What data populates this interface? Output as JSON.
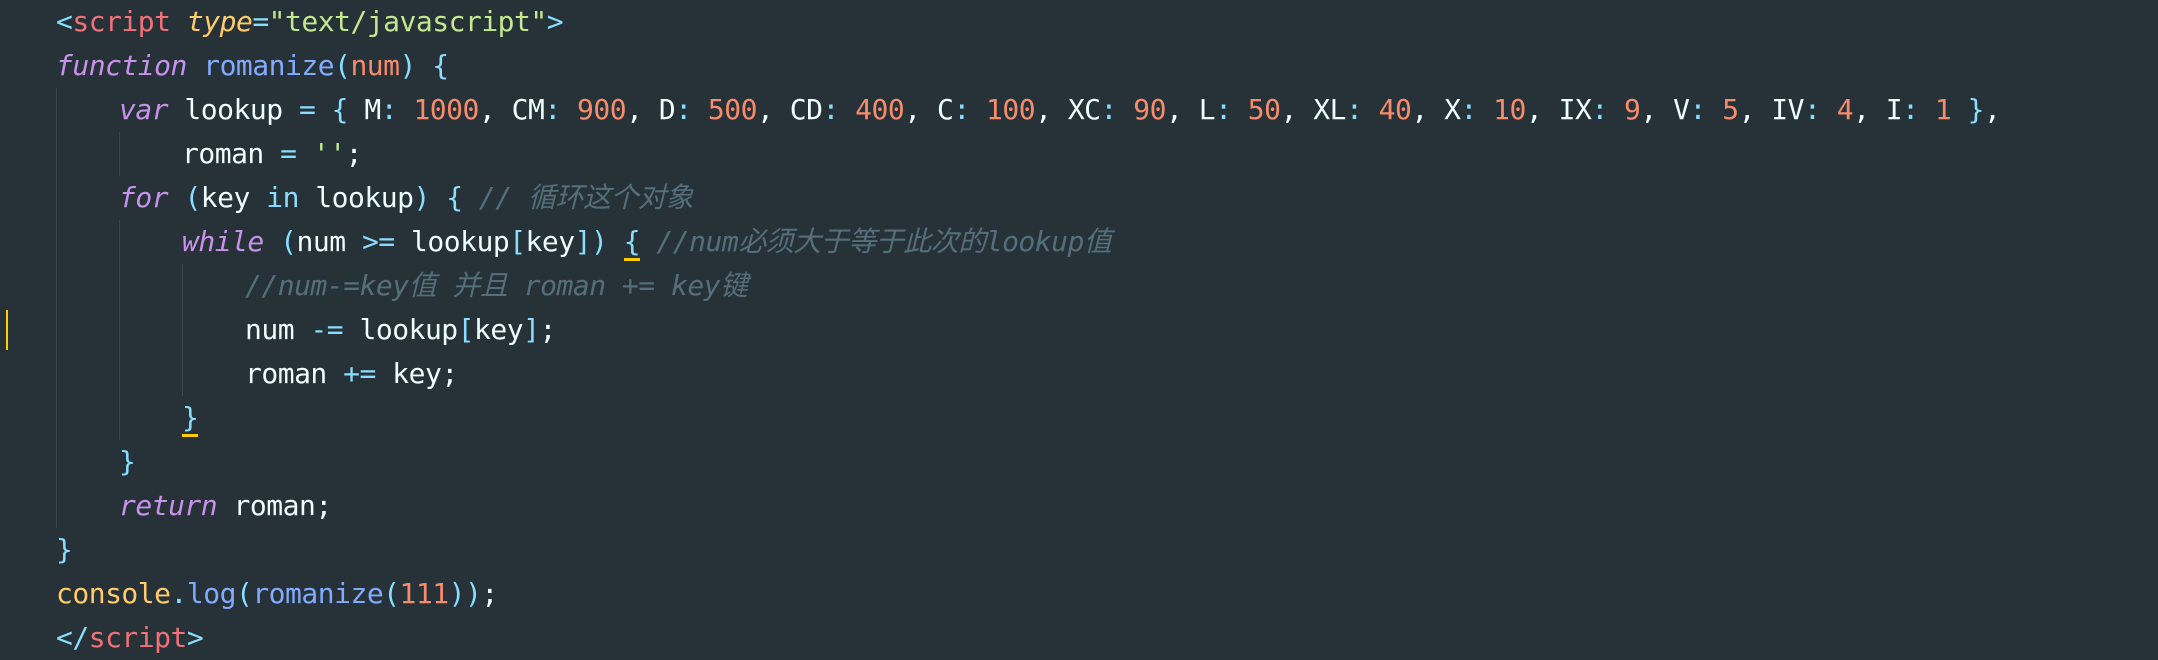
{
  "editor": {
    "accent_colors": {
      "background": "#263238",
      "keyword": "#C792EA",
      "function": "#82AAFF",
      "number": "#F78C6C",
      "string": "#C3E88D",
      "comment": "#546E7A",
      "caret": "#FFCC00"
    },
    "lines": [
      {
        "indent": 0,
        "tokens": [
          {
            "t": "<",
            "c": "tag"
          },
          {
            "t": "script",
            "c": "name"
          },
          {
            "t": " ",
            "c": "txt"
          },
          {
            "t": "type",
            "c": "attr"
          },
          {
            "t": "=",
            "c": "op"
          },
          {
            "t": "\"text/javascript\"",
            "c": "str"
          },
          {
            "t": ">",
            "c": "tag"
          }
        ]
      },
      {
        "indent": 0,
        "tokens": [
          {
            "t": "function",
            "c": "kw"
          },
          {
            "t": " ",
            "c": "txt"
          },
          {
            "t": "romanize",
            "c": "fn"
          },
          {
            "t": "(",
            "c": "punc"
          },
          {
            "t": "num",
            "c": "param"
          },
          {
            "t": ")",
            "c": "punc"
          },
          {
            "t": " ",
            "c": "txt"
          },
          {
            "t": "{",
            "c": "punc"
          }
        ]
      },
      {
        "indent": 1,
        "tokens": [
          {
            "t": "var",
            "c": "kw"
          },
          {
            "t": " lookup ",
            "c": "txt"
          },
          {
            "t": "=",
            "c": "op"
          },
          {
            "t": " ",
            "c": "txt"
          },
          {
            "t": "{",
            "c": "punc"
          },
          {
            "t": " M",
            "c": "txt"
          },
          {
            "t": ":",
            "c": "punc"
          },
          {
            "t": " ",
            "c": "txt"
          },
          {
            "t": "1000",
            "c": "num"
          },
          {
            "t": ", CM",
            "c": "txt"
          },
          {
            "t": ":",
            "c": "punc"
          },
          {
            "t": " ",
            "c": "txt"
          },
          {
            "t": "900",
            "c": "num"
          },
          {
            "t": ", D",
            "c": "txt"
          },
          {
            "t": ":",
            "c": "punc"
          },
          {
            "t": " ",
            "c": "txt"
          },
          {
            "t": "500",
            "c": "num"
          },
          {
            "t": ", CD",
            "c": "txt"
          },
          {
            "t": ":",
            "c": "punc"
          },
          {
            "t": " ",
            "c": "txt"
          },
          {
            "t": "400",
            "c": "num"
          },
          {
            "t": ", C",
            "c": "txt"
          },
          {
            "t": ":",
            "c": "punc"
          },
          {
            "t": " ",
            "c": "txt"
          },
          {
            "t": "100",
            "c": "num"
          },
          {
            "t": ", XC",
            "c": "txt"
          },
          {
            "t": ":",
            "c": "punc"
          },
          {
            "t": " ",
            "c": "txt"
          },
          {
            "t": "90",
            "c": "num"
          },
          {
            "t": ", L",
            "c": "txt"
          },
          {
            "t": ":",
            "c": "punc"
          },
          {
            "t": " ",
            "c": "txt"
          },
          {
            "t": "50",
            "c": "num"
          },
          {
            "t": ", XL",
            "c": "txt"
          },
          {
            "t": ":",
            "c": "punc"
          },
          {
            "t": " ",
            "c": "txt"
          },
          {
            "t": "40",
            "c": "num"
          },
          {
            "t": ", X",
            "c": "txt"
          },
          {
            "t": ":",
            "c": "punc"
          },
          {
            "t": " ",
            "c": "txt"
          },
          {
            "t": "10",
            "c": "num"
          },
          {
            "t": ", IX",
            "c": "txt"
          },
          {
            "t": ":",
            "c": "punc"
          },
          {
            "t": " ",
            "c": "txt"
          },
          {
            "t": "9",
            "c": "num"
          },
          {
            "t": ", V",
            "c": "txt"
          },
          {
            "t": ":",
            "c": "punc"
          },
          {
            "t": " ",
            "c": "txt"
          },
          {
            "t": "5",
            "c": "num"
          },
          {
            "t": ", IV",
            "c": "txt"
          },
          {
            "t": ":",
            "c": "punc"
          },
          {
            "t": " ",
            "c": "txt"
          },
          {
            "t": "4",
            "c": "num"
          },
          {
            "t": ", I",
            "c": "txt"
          },
          {
            "t": ":",
            "c": "punc"
          },
          {
            "t": " ",
            "c": "txt"
          },
          {
            "t": "1",
            "c": "num"
          },
          {
            "t": " ",
            "c": "txt"
          },
          {
            "t": "}",
            "c": "punc"
          },
          {
            "t": ",",
            "c": "txt"
          }
        ]
      },
      {
        "indent": 2,
        "tokens": [
          {
            "t": "roman ",
            "c": "txt"
          },
          {
            "t": "=",
            "c": "op"
          },
          {
            "t": " ",
            "c": "txt"
          },
          {
            "t": "''",
            "c": "str"
          },
          {
            "t": ";",
            "c": "txt"
          }
        ]
      },
      {
        "indent": 1,
        "tokens": [
          {
            "t": "for",
            "c": "kw"
          },
          {
            "t": " ",
            "c": "txt"
          },
          {
            "t": "(",
            "c": "punc"
          },
          {
            "t": "key ",
            "c": "txt"
          },
          {
            "t": "in",
            "c": "op"
          },
          {
            "t": " lookup",
            "c": "txt"
          },
          {
            "t": ")",
            "c": "punc"
          },
          {
            "t": " ",
            "c": "txt"
          },
          {
            "t": "{",
            "c": "punc"
          },
          {
            "t": " ",
            "c": "txt"
          },
          {
            "t": "// 循环这个对象",
            "c": "cm"
          }
        ]
      },
      {
        "indent": 2,
        "tokens": [
          {
            "t": "while",
            "c": "kw"
          },
          {
            "t": " ",
            "c": "txt"
          },
          {
            "t": "(",
            "c": "punc"
          },
          {
            "t": "num ",
            "c": "txt"
          },
          {
            "t": ">=",
            "c": "op"
          },
          {
            "t": " lookup",
            "c": "txt"
          },
          {
            "t": "[",
            "c": "punc"
          },
          {
            "t": "key",
            "c": "txt"
          },
          {
            "t": "]",
            "c": "punc"
          },
          {
            "t": ")",
            "c": "punc"
          },
          {
            "t": " ",
            "c": "txt"
          },
          {
            "t": "{",
            "c": "punc",
            "u": true
          },
          {
            "t": " ",
            "c": "txt"
          },
          {
            "t": "//num必须大于等于此次的lookup值",
            "c": "cm"
          }
        ]
      },
      {
        "indent": 3,
        "tokens": [
          {
            "t": "//num-=key值 并且 roman += key键",
            "c": "cm"
          }
        ]
      },
      {
        "indent": 3,
        "tokens": [
          {
            "t": "num ",
            "c": "txt"
          },
          {
            "t": "-=",
            "c": "op"
          },
          {
            "t": " lookup",
            "c": "txt"
          },
          {
            "t": "[",
            "c": "punc"
          },
          {
            "t": "key",
            "c": "txt"
          },
          {
            "t": "]",
            "c": "punc"
          },
          {
            "t": ";",
            "c": "txt"
          }
        ]
      },
      {
        "indent": 3,
        "tokens": [
          {
            "t": "roman ",
            "c": "txt"
          },
          {
            "t": "+=",
            "c": "op"
          },
          {
            "t": " key",
            "c": "txt"
          },
          {
            "t": ";",
            "c": "txt"
          }
        ]
      },
      {
        "indent": 2,
        "tokens": [
          {
            "t": "}",
            "c": "punc",
            "u": true
          }
        ]
      },
      {
        "indent": 1,
        "tokens": [
          {
            "t": "}",
            "c": "punc"
          }
        ]
      },
      {
        "indent": 1,
        "tokens": [
          {
            "t": "return",
            "c": "kw"
          },
          {
            "t": " roman",
            "c": "txt"
          },
          {
            "t": ";",
            "c": "txt"
          }
        ]
      },
      {
        "indent": 0,
        "tokens": [
          {
            "t": "}",
            "c": "punc"
          }
        ]
      },
      {
        "indent": 0,
        "tokens": [
          {
            "t": "console",
            "c": "obj"
          },
          {
            "t": ".",
            "c": "punc"
          },
          {
            "t": "log",
            "c": "meth"
          },
          {
            "t": "(",
            "c": "punc"
          },
          {
            "t": "romanize",
            "c": "fn"
          },
          {
            "t": "(",
            "c": "punc"
          },
          {
            "t": "111",
            "c": "num"
          },
          {
            "t": ")",
            "c": "punc"
          },
          {
            "t": ")",
            "c": "punc"
          },
          {
            "t": ";",
            "c": "txt"
          }
        ]
      },
      {
        "indent": 0,
        "tokens": [
          {
            "t": "</",
            "c": "tag"
          },
          {
            "t": "script",
            "c": "name"
          },
          {
            "t": ">",
            "c": "tag"
          }
        ]
      }
    ]
  }
}
